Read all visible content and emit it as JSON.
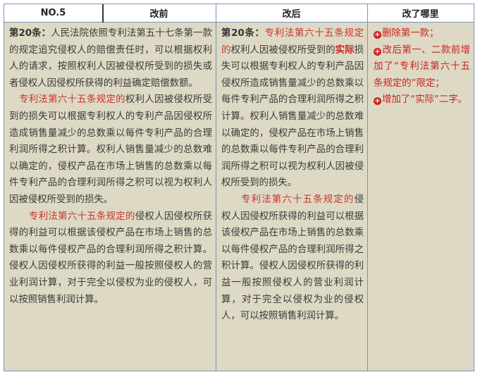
{
  "header": {
    "no": "NO.5",
    "before": "改前",
    "after": "改后",
    "changes": "改了哪里"
  },
  "before": {
    "p1_title": "第20条：",
    "p1_text": "人民法院依照专利法第五十七条第一款的规定追究侵权人的赔偿责任时，可以根据权利人的请求，按照权利人因被侵权所受到的损失或者侵权人因侵权所获得的利益确定赔偿数额。",
    "p2_red": "专利法第六十五条规定的",
    "p2_text": "权利人因被侵权所受到的损失可以根据专利权人的专利产品因侵权所造成销售量减少的总数乘以每件专利产品的合理利润所得之积计算。权利人销售量减少的总数难以确定的，侵权产品在市场上销售的总数乘以每件专利产品的合理利润所得之积可以视为权利人因被侵权所受到的损失。",
    "p3_red": "专利法第六十五条规定的",
    "p3_text": "侵权人因侵权所获得的利益可以根据该侵权产品在市场上销售的总数乘以每件侵权产品的合理利润所得之积计算。侵权人因侵权所获得的利益一般按照侵权人的营业利润计算，对于完全以侵权为业的侵权人，可以按照销售利润计算。"
  },
  "after": {
    "p1_title": "第20条：",
    "p1_red": "专利法第六十五条规定的",
    "p1_text_a": "权利人因被侵权所受到的",
    "p1_bold": "实际",
    "p1_text_b": "损失可以根据专利权人的专利产品因侵权所造成销售量减少的总数乘以每件专利产品的合理利润所得之积计算。权利人销售量减少的总数难以确定的，侵权产品在市场上销售的总数乘以每件专利产品的合理利润所得之积可以视为权利人因被侵权所受到的损失。",
    "p2_red": "专利法第六十五条规定的",
    "p2_text": "侵权人因侵权所获得的利益可以根据该侵权产品在市场上销售的总数乘以每件侵权产品的合理利润所得之积计算。侵权人因侵权所获得的利益一般按照侵权人的营业利润计算，对于完全以侵权为业的侵权人，可以按照销售利润计算。"
  },
  "changes": {
    "items": [
      "删除第一款；",
      "改后第一、二款前增加了“专利法第六十五条规定的”限定；",
      "增加了“实际”二字。"
    ],
    "bullet_glyph": "+"
  },
  "colors": {
    "cell_bg": "#ddd9c4",
    "border": "#7a93b8",
    "accent_red": "#cc2222",
    "text": "#3a3a3a"
  }
}
